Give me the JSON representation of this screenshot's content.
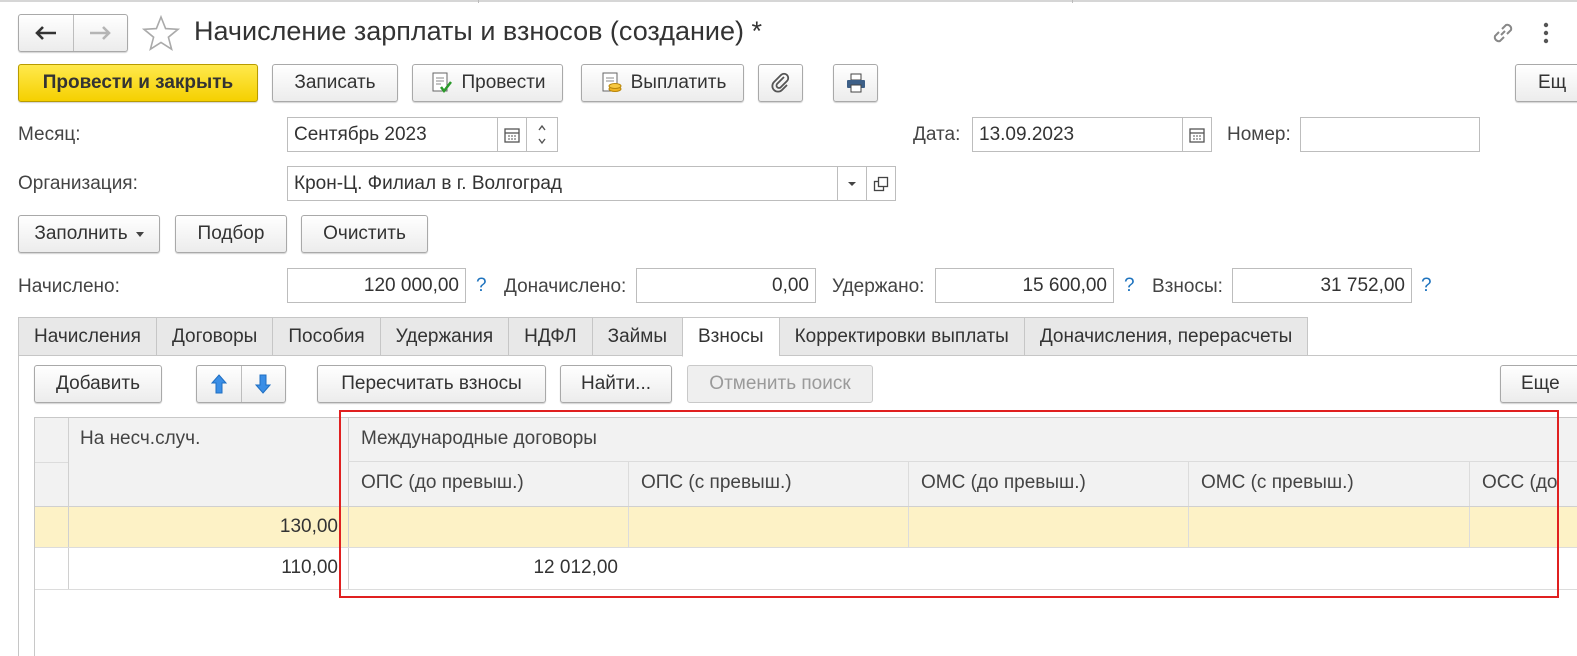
{
  "window": {
    "title": "Начисление зарплаты и взносов (создание) *"
  },
  "toolbar": {
    "post_close": "Провести и закрыть",
    "save": "Записать",
    "post": "Провести",
    "pay": "Выплатить",
    "more": "Ещ"
  },
  "form": {
    "month_label": "Месяц:",
    "month_value": "Сентябрь 2023",
    "date_label": "Дата:",
    "date_value": "13.09.2023",
    "number_label": "Номер:",
    "number_value": "",
    "org_label": "Организация:",
    "org_value": "Крон-Ц. Филиал в г. Волгоград"
  },
  "actions": {
    "fill": "Заполнить",
    "select": "Подбор",
    "clear": "Очистить"
  },
  "totals": {
    "accrued_label": "Начислено:",
    "accrued_value": "120 000,00",
    "extra_label": "Доначислено:",
    "extra_value": "0,00",
    "withheld_label": "Удержано:",
    "withheld_value": "15 600,00",
    "contrib_label": "Взносы:",
    "contrib_value": "31 752,00",
    "help": "?"
  },
  "tabs": [
    {
      "label": "Начисления",
      "active": false
    },
    {
      "label": "Договоры",
      "active": false
    },
    {
      "label": "Пособия",
      "active": false
    },
    {
      "label": "Удержания",
      "active": false
    },
    {
      "label": "НДФЛ",
      "active": false
    },
    {
      "label": "Займы",
      "active": false
    },
    {
      "label": "Взносы",
      "active": true
    },
    {
      "label": "Корректировки выплаты",
      "active": false
    },
    {
      "label": "Доначисления, перерасчеты",
      "active": false
    }
  ],
  "tab_toolbar": {
    "add": "Добавить",
    "recalc": "Пересчитать взносы",
    "find": "Найти...",
    "cancel_search": "Отменить поиск",
    "more": "Еще"
  },
  "table": {
    "col_accident": "На несч.случ.",
    "group_intl": "Международные договоры",
    "col_ops_before": "ОПС (до превыш.)",
    "col_ops_after": "ОПС (с превыш.)",
    "col_oms_before": "ОМС (до превыш.)",
    "col_oms_after": "ОМС (с превыш.)",
    "col_oss_before": "ОСС (до",
    "rows": [
      {
        "accident": "130,00",
        "ops_before": "",
        "ops_after": "",
        "oms_before": "",
        "oms_after": "",
        "oss_before": ""
      },
      {
        "accident": "110,00",
        "ops_before": "12 012,00",
        "ops_after": "",
        "oms_before": "",
        "oms_after": "",
        "oss_before": ""
      }
    ]
  }
}
